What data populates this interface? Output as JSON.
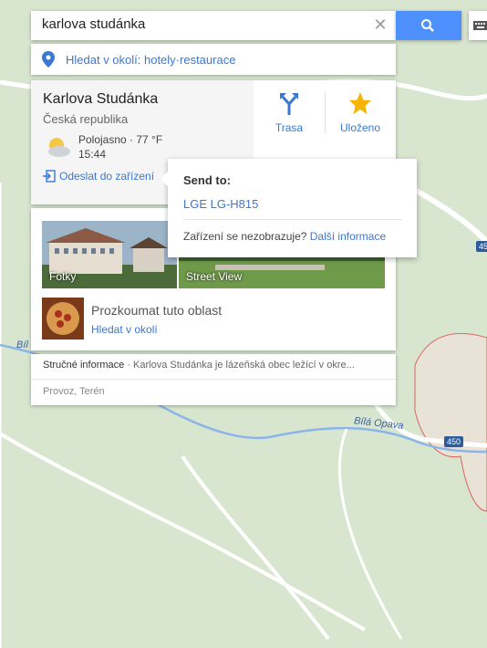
{
  "search": {
    "query": "karlova studánka"
  },
  "nearby": {
    "label": "Hledat v okolí: hotely·restaurace"
  },
  "place": {
    "name": "Karlova Studánka",
    "country": "Česká republika",
    "weather_condition": "Polojasno · 77 °F",
    "weather_time": "15:44",
    "send_to_device": "Odeslat do zařízení"
  },
  "actions": {
    "route": "Trasa",
    "saved": "Uloženo"
  },
  "photos": {
    "photos_label": "Fotky",
    "street_view_label": "Street View"
  },
  "explore": {
    "title": "Prozkoumat tuto oblast",
    "link": "Hledat v okolí"
  },
  "info": {
    "summary_label": "Stručné informace",
    "summary_text": " · Karlova Studánka je lázeňská obec ležící v okre...",
    "layers": "Provoz, Terén"
  },
  "popup": {
    "title": "Send to:",
    "device": "LGE LG-H815",
    "question": "Zařízení se nezobrazuje? ",
    "more_info": "Další informace"
  },
  "map": {
    "river_name": "Bílá Opava",
    "river_name_left": "Bíl",
    "road_450": "450",
    "road_45": "45"
  },
  "colors": {
    "accent": "#4d90fe",
    "link": "#3a78d1",
    "map_bg": "#d8e6cf",
    "star": "#f4b400"
  }
}
